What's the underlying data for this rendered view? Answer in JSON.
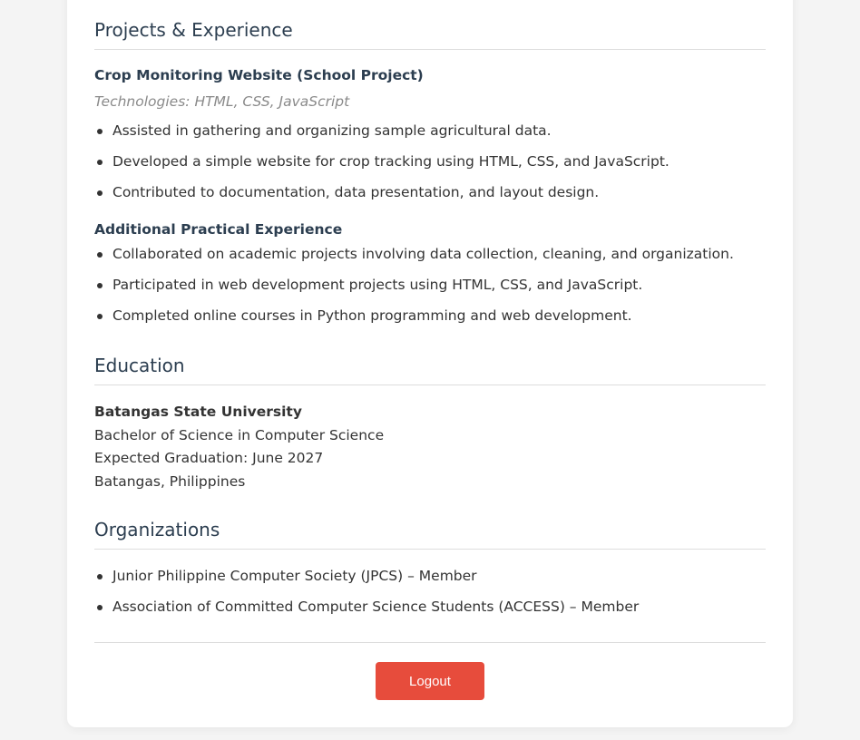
{
  "projects": {
    "heading": "Projects & Experience",
    "project1": {
      "title": "Crop Monitoring Website (School Project)",
      "technologies": "Technologies: HTML, CSS, JavaScript",
      "bullets": [
        "Assisted in gathering and organizing sample agricultural data.",
        "Developed a simple website for crop tracking using HTML, CSS, and JavaScript.",
        "Contributed to documentation, data presentation, and layout design."
      ]
    },
    "additional": {
      "title": "Additional Practical Experience",
      "bullets": [
        "Collaborated on academic projects involving data collection, cleaning, and organization.",
        "Participated in web development projects using HTML, CSS, and JavaScript.",
        "Completed online courses in Python programming and web development."
      ]
    }
  },
  "education": {
    "heading": "Education",
    "school": "Batangas State University",
    "degree": "Bachelor of Science in Computer Science",
    "graduation": "Expected Graduation: June 2027",
    "location": "Batangas, Philippines"
  },
  "organizations": {
    "heading": "Organizations",
    "items": [
      "Junior Philippine Computer Society (JPCS) – Member",
      "Association of Committed Computer Science Students (ACCESS) – Member"
    ]
  },
  "actions": {
    "logout_label": "Logout"
  },
  "colors": {
    "page_background": "#f4f4f4",
    "card_background": "#ffffff",
    "heading_text": "#2c3e50",
    "logout_button": "#e74c3c"
  }
}
